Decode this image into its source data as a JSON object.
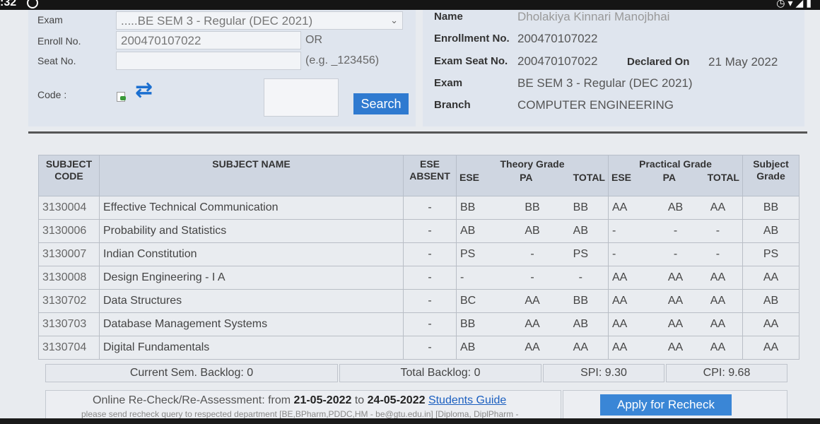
{
  "status_bar": {
    "time": ":32"
  },
  "search": {
    "exam_label": "Exam",
    "exam_value": ".....BE SEM 3 - Regular (DEC 2021)",
    "enroll_label": "Enroll No.",
    "enroll_value": "200470107022",
    "or_text": "OR",
    "seat_label": "Seat No.",
    "seat_value": "",
    "seat_hint": "(e.g. _123456)",
    "code_label": "Code :",
    "search_button": "Search"
  },
  "result_info": {
    "name_label": "Name",
    "name_value": "Dholakiya Kinnari Manojbhai",
    "enrollment_label": "Enrollment No.",
    "enrollment_value": "200470107022",
    "seat_label": "Exam Seat No.",
    "seat_value": "200470107022",
    "declared_label": "Declared On",
    "declared_value": "21 May 2022",
    "exam_label": "Exam",
    "exam_value": "BE SEM 3 - Regular (DEC 2021)",
    "branch_label": "Branch",
    "branch_value": "COMPUTER ENGINEERING"
  },
  "table": {
    "headers": {
      "subject_code": "SUBJECT CODE",
      "subject_name": "SUBJECT NAME",
      "ese_absent": "ESE ABSENT",
      "theory_grade": "Theory Grade",
      "practical_grade": "Practical Grade",
      "subject_grade": "Subject Grade",
      "ese": "ESE",
      "pa": "PA",
      "total": "TOTAL"
    },
    "rows": [
      {
        "code": "3130004",
        "name": "Effective Technical Communication",
        "absent": "-",
        "t_ese": "BB",
        "t_pa": "BB",
        "t_total": "BB",
        "p_ese": "AA",
        "p_pa": "AB",
        "p_total": "AA",
        "grade": "BB"
      },
      {
        "code": "3130006",
        "name": "Probability and Statistics",
        "absent": "-",
        "t_ese": "AB",
        "t_pa": "AB",
        "t_total": "AB",
        "p_ese": "-",
        "p_pa": "-",
        "p_total": "-",
        "grade": "AB"
      },
      {
        "code": "3130007",
        "name": "Indian Constitution",
        "absent": "-",
        "t_ese": "PS",
        "t_pa": "-",
        "t_total": "PS",
        "p_ese": "-",
        "p_pa": "-",
        "p_total": "-",
        "grade": "PS"
      },
      {
        "code": "3130008",
        "name": "Design Engineering - I A",
        "absent": "-",
        "t_ese": "-",
        "t_pa": "-",
        "t_total": "-",
        "p_ese": "AA",
        "p_pa": "AA",
        "p_total": "AA",
        "grade": "AA"
      },
      {
        "code": "3130702",
        "name": "Data Structures",
        "absent": "-",
        "t_ese": "BC",
        "t_pa": "AA",
        "t_total": "BB",
        "p_ese": "AA",
        "p_pa": "AA",
        "p_total": "AA",
        "grade": "AB"
      },
      {
        "code": "3130703",
        "name": "Database Management Systems",
        "absent": "-",
        "t_ese": "BB",
        "t_pa": "AA",
        "t_total": "AB",
        "p_ese": "AA",
        "p_pa": "AA",
        "p_total": "AA",
        "grade": "AA"
      },
      {
        "code": "3130704",
        "name": "Digital Fundamentals",
        "absent": "-",
        "t_ese": "AB",
        "t_pa": "AA",
        "t_total": "AA",
        "p_ese": "AA",
        "p_pa": "AA",
        "p_total": "AA",
        "grade": "AA"
      }
    ]
  },
  "summary": {
    "current_backlog": "Current Sem. Backlog: 0",
    "total_backlog": "Total Backlog: 0",
    "spi": "SPI: 9.30",
    "cpi": "CPI: 9.68"
  },
  "recheck": {
    "text_prefix": "Online Re-Check/Re-Assessment: from",
    "from_date": "21-05-2022",
    "to_word": "to",
    "to_date": "24-05-2022",
    "guide_link": "Students Guide",
    "note": "please send recheck query to respected department [BE,BPharm,PDDC,HM - be@gtu.edu.in] [Diploma, DiplPharm -",
    "apply_button": "Apply for Recheck"
  }
}
